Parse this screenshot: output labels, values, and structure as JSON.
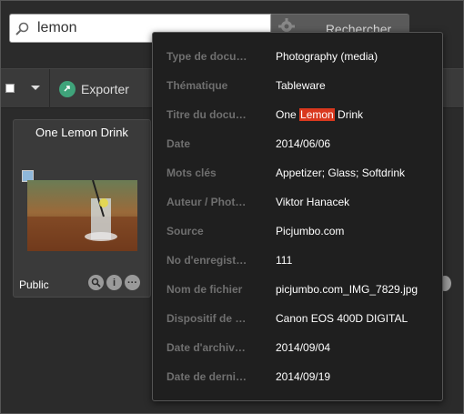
{
  "search": {
    "query": "lemon",
    "button_label": "Rechercher"
  },
  "toolbar": {
    "export_label": "Exporter"
  },
  "card": {
    "title": "One Lemon Drink",
    "access": "Public"
  },
  "metadata": {
    "rows": [
      {
        "label": "Type de docu…",
        "value": "Photography (media)"
      },
      {
        "label": "Thématique",
        "value": "Tableware"
      },
      {
        "label": "Titre du docu…",
        "value_before": "One ",
        "value_highlight": "Lemon",
        "value_after": " Drink"
      },
      {
        "label": "Date",
        "value": "2014/06/06"
      },
      {
        "label": "Mots clés",
        "value": "Appetizer; Glass; Softdrink"
      },
      {
        "label": "Auteur / Phot…",
        "value": "Viktor Hanacek"
      },
      {
        "label": "Source",
        "value": "Picjumbo.com"
      },
      {
        "label": "No d'enregist…",
        "value": "111"
      },
      {
        "label": "Nom de fichier",
        "value": "picjumbo.com_IMG_7829.jpg"
      },
      {
        "label": "Dispositif de …",
        "value": "Canon EOS 400D DIGITAL"
      },
      {
        "label": "Date d'archiv…",
        "value": "2014/09/04"
      },
      {
        "label": "Date de derni…",
        "value": "2014/09/19"
      }
    ]
  },
  "colors": {
    "highlight": "#d9381e",
    "export_icon": "#3fa37a",
    "background": "#2b2b2b"
  },
  "icons": {
    "search": "magnifier-icon",
    "settings": "gear-icon",
    "export": "export-icon",
    "preview": "magnifier-icon",
    "info": "info-icon",
    "more": "ellipsis-icon"
  }
}
